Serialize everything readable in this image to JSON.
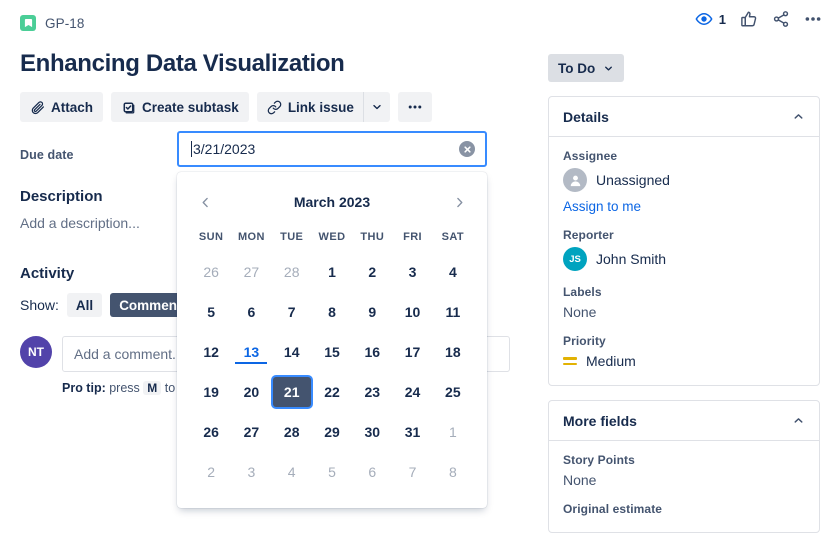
{
  "breadcrumb": {
    "issue_key": "GP-18",
    "icon": "story-icon"
  },
  "header": {
    "title": "Enhancing Data Visualization",
    "top_icons": {
      "watch_icon": "eye-icon",
      "watch_count": "1",
      "like_icon": "thumbs-up-icon",
      "share_icon": "share-icon",
      "more_icon": "more-options-icon"
    }
  },
  "actions": {
    "attach": "Attach",
    "create_subtask": "Create subtask",
    "link_issue": "Link issue",
    "caret_icon": "chevron-down-icon",
    "more_icon": "more-options-icon"
  },
  "fields": {
    "due_date_label": "Due date",
    "description_label": "Description",
    "description_placeholder": "Add a description...",
    "activity_label": "Activity",
    "show_label": "Show:",
    "show_all": "All",
    "show_comments": "Comments"
  },
  "date_input": {
    "value": "3/21/2023",
    "clear_icon": "clear-icon"
  },
  "calendar": {
    "month_title": "March 2023",
    "prev_icon": "chevron-left-icon",
    "next_icon": "chevron-right-icon",
    "weekdays": [
      "SUN",
      "MON",
      "TUE",
      "WED",
      "THU",
      "FRI",
      "SAT"
    ],
    "selected_day": 21,
    "today_day": 13,
    "weeks": [
      [
        {
          "n": "26",
          "state": "out"
        },
        {
          "n": "27",
          "state": "out"
        },
        {
          "n": "28",
          "state": "out"
        },
        {
          "n": "1",
          "state": "in"
        },
        {
          "n": "2",
          "state": "in"
        },
        {
          "n": "3",
          "state": "in"
        },
        {
          "n": "4",
          "state": "in"
        }
      ],
      [
        {
          "n": "5",
          "state": "in"
        },
        {
          "n": "6",
          "state": "in"
        },
        {
          "n": "7",
          "state": "in"
        },
        {
          "n": "8",
          "state": "in"
        },
        {
          "n": "9",
          "state": "in"
        },
        {
          "n": "10",
          "state": "in"
        },
        {
          "n": "11",
          "state": "in"
        }
      ],
      [
        {
          "n": "12",
          "state": "in"
        },
        {
          "n": "13",
          "state": "today"
        },
        {
          "n": "14",
          "state": "in"
        },
        {
          "n": "15",
          "state": "in"
        },
        {
          "n": "16",
          "state": "in"
        },
        {
          "n": "17",
          "state": "in"
        },
        {
          "n": "18",
          "state": "in"
        }
      ],
      [
        {
          "n": "19",
          "state": "in"
        },
        {
          "n": "20",
          "state": "in"
        },
        {
          "n": "21",
          "state": "sel"
        },
        {
          "n": "22",
          "state": "in"
        },
        {
          "n": "23",
          "state": "in"
        },
        {
          "n": "24",
          "state": "in"
        },
        {
          "n": "25",
          "state": "in"
        }
      ],
      [
        {
          "n": "26",
          "state": "in"
        },
        {
          "n": "27",
          "state": "in"
        },
        {
          "n": "28",
          "state": "in"
        },
        {
          "n": "29",
          "state": "in"
        },
        {
          "n": "30",
          "state": "in"
        },
        {
          "n": "31",
          "state": "in"
        },
        {
          "n": "1",
          "state": "out"
        }
      ],
      [
        {
          "n": "2",
          "state": "out"
        },
        {
          "n": "3",
          "state": "out"
        },
        {
          "n": "4",
          "state": "out"
        },
        {
          "n": "5",
          "state": "out"
        },
        {
          "n": "6",
          "state": "out"
        },
        {
          "n": "7",
          "state": "out"
        },
        {
          "n": "8",
          "state": "out"
        }
      ]
    ]
  },
  "comment": {
    "avatar_initials": "NT",
    "placeholder": "Add a comment...",
    "pro_tip_prefix": "Pro tip:",
    "pro_tip_text": "press",
    "pro_tip_key": "M",
    "pro_tip_suffix": "to comment"
  },
  "sidebar": {
    "status": {
      "label": "To Do",
      "caret_icon": "chevron-down-icon"
    },
    "details": {
      "title": "Details",
      "collapse_icon": "chevron-up-icon",
      "assignee_label": "Assignee",
      "assignee_value": "Unassigned",
      "assignee_avatar_icon": "person-icon",
      "assign_to_me": "Assign to me",
      "reporter_label": "Reporter",
      "reporter_value": "John Smith",
      "reporter_initials": "JS",
      "labels_label": "Labels",
      "labels_value": "None",
      "priority_label": "Priority",
      "priority_value": "Medium",
      "priority_icon": "priority-medium-icon"
    },
    "more_fields": {
      "title": "More fields",
      "collapse_icon": "chevron-up-icon",
      "story_points_label": "Story Points",
      "story_points_value": "None",
      "original_estimate_label": "Original estimate"
    }
  },
  "colors": {
    "accent_blue": "#0C66E4",
    "focus_blue": "#388BFF",
    "text": "#172B4D",
    "subtle": "#44546F",
    "story_green": "#4BCE97",
    "avatar_purple": "#5243AA",
    "avatar_teal": "#00A3BF",
    "priority_yellow": "#E2B203"
  }
}
